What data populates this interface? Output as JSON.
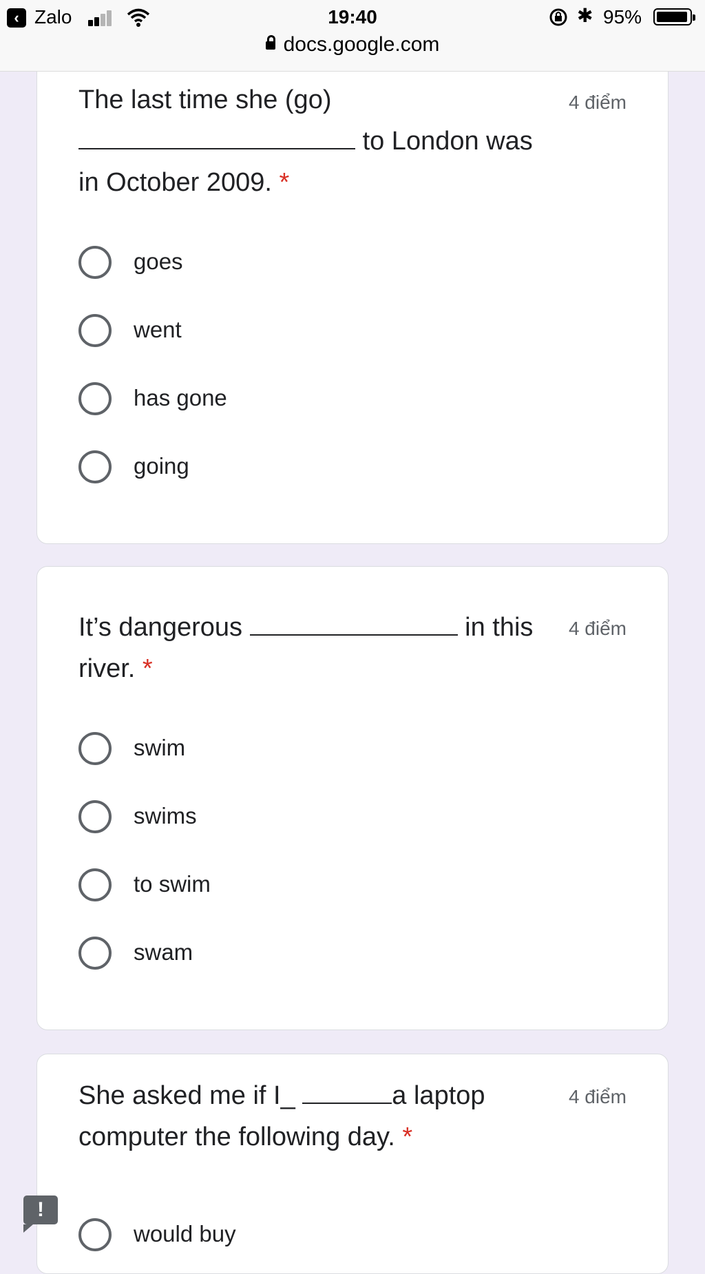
{
  "status_bar": {
    "back_app": "Zalo",
    "time": "19:40",
    "battery": "95%",
    "battery_level": 0.95,
    "icons": [
      "signal-icon",
      "wifi-icon",
      "rotation-lock-icon",
      "bluetooth-icon",
      "battery-icon"
    ]
  },
  "browser": {
    "url": "docs.google.com"
  },
  "questions": [
    {
      "prefix": "The last time she (go) ",
      "suffix": " to London was in October 2009.",
      "required_mark": "*",
      "points": "4 điểm",
      "options": [
        "goes",
        "went",
        "has gone",
        "going"
      ]
    },
    {
      "prefix": "It’s dangerous ",
      "suffix": " in this river.",
      "required_mark": "*",
      "points": "4 điểm",
      "options": [
        "swim",
        "swims",
        "to swim",
        "swam"
      ]
    },
    {
      "prefix": "She asked me if I_ ",
      "suffix": "a laptop computer the following day.",
      "required_mark": "*",
      "points": "4 điểm",
      "options": [
        "would buy"
      ]
    }
  ],
  "feedback_icon": "report-problem-icon",
  "feedback_glyph": "!"
}
